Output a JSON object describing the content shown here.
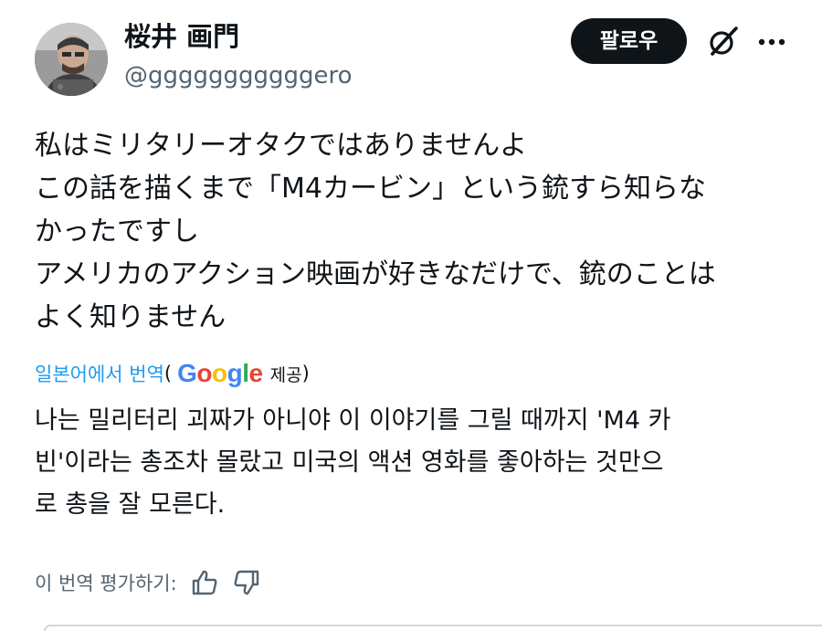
{
  "post": {
    "author": {
      "display_name": "桜井 画門",
      "handle": "@gggggggggggero"
    },
    "follow_label": "팔로우",
    "icons": {
      "avatar": "avatar-photo",
      "grok": "grok-slash-circle-icon",
      "more": "more-dots-icon"
    },
    "original_lines": [
      "私はミリタリーオタクではありませんよ",
      "この話を描くまで「M4カービン」という銃すら知らな",
      "かったですし",
      "アメリカのアクション映画が好きなだけで、銃のことは",
      "よく知りません"
    ],
    "translation": {
      "label": "일본어에서 번역",
      "paren_open": "(",
      "google_letters": [
        "G",
        "o",
        "o",
        "g",
        "l",
        "e"
      ],
      "provided": "제공",
      "paren_close": ")"
    },
    "translated_lines": [
      "나는 밀리터리 괴짜가 아니야 이 이야기를 그릴 때까지 'M4 카",
      "빈'이라는 총조차 몰랐고 미국의 액션 영화를 좋아하는 것만으",
      "로 총을 잘 모른다."
    ],
    "rate_label": "이 번역 평가하기:",
    "rate_icons": [
      "thumbs-up-icon",
      "thumbs-down-icon"
    ]
  },
  "colors": {
    "text": "#0f1419",
    "secondary": "#536471",
    "link": "#1d9bf0",
    "button_bg": "#0f1419",
    "button_text": "#ffffff"
  }
}
